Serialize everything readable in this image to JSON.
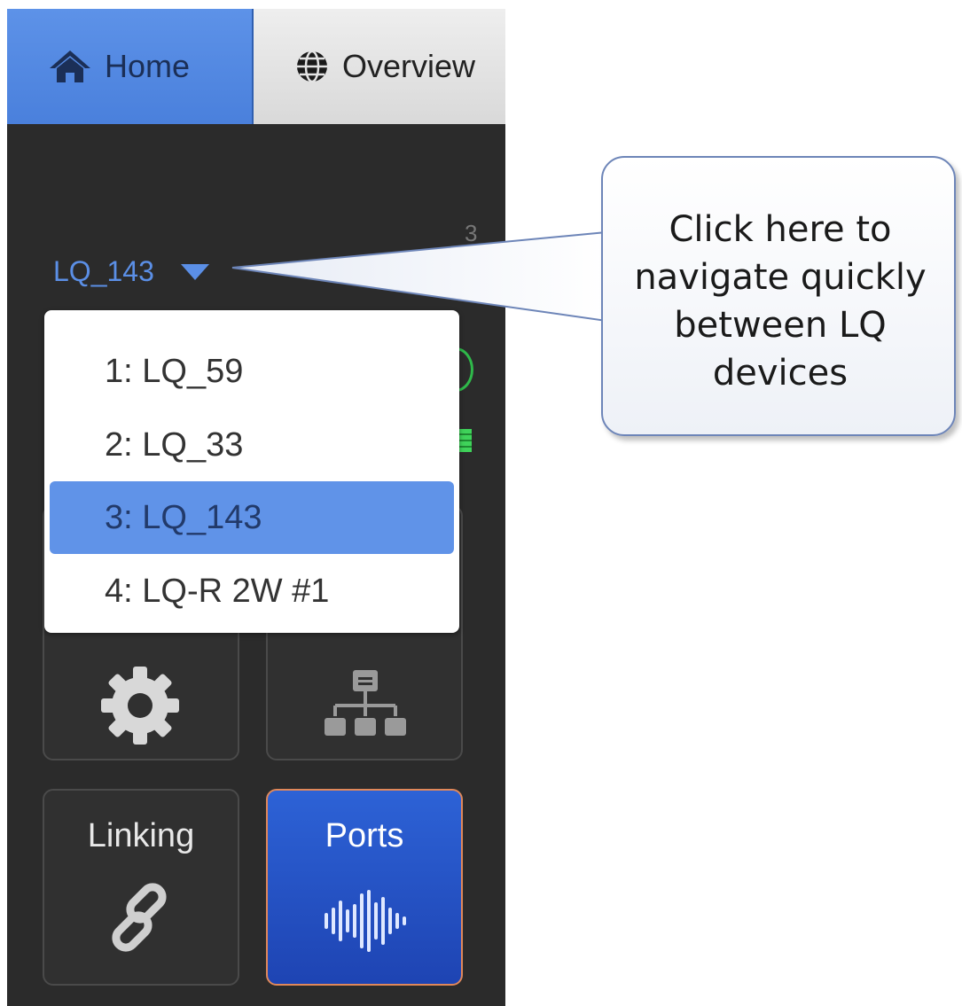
{
  "tabs": {
    "home": {
      "label": "Home",
      "icon": "home-icon"
    },
    "overview": {
      "label": "Overview",
      "icon": "globe-icon"
    }
  },
  "device_count": "3",
  "device_selector": {
    "current": "LQ_143"
  },
  "dropdown": {
    "items": [
      {
        "label": "1: LQ_59",
        "selected": false
      },
      {
        "label": "2: LQ_33",
        "selected": false
      },
      {
        "label": "3: LQ_143",
        "selected": true
      },
      {
        "label": "4: LQ-R 2W #1",
        "selected": false
      }
    ]
  },
  "tiles": {
    "settings": {
      "icon": "gear-icon"
    },
    "network": {
      "icon": "network-icon"
    },
    "linking": {
      "label": "Linking",
      "icon": "chain-link-icon"
    },
    "ports": {
      "label": "Ports",
      "icon": "audio-wave-icon"
    }
  },
  "callout": {
    "lines": [
      "Click here to",
      "navigate quickly",
      "between LQ",
      "devices"
    ]
  },
  "colors": {
    "accent": "#5b8fe6",
    "selected_row": "#6093e8",
    "ports_tile": "#2a57cc",
    "status_green": "#2fb84a"
  }
}
